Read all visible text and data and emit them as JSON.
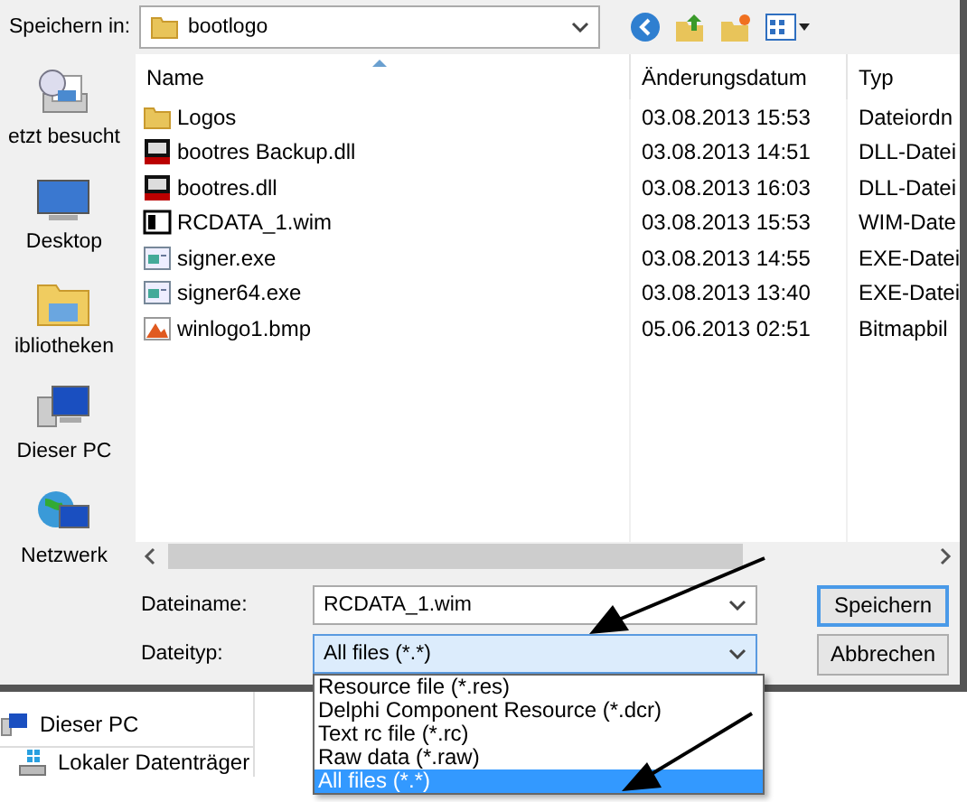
{
  "dialog": {
    "save_in_label": "Speichern in:",
    "folder": "bootlogo",
    "places": [
      {
        "label": "etzt besucht",
        "kind": "recent"
      },
      {
        "label": "Desktop",
        "kind": "desktop"
      },
      {
        "label": "ibliotheken",
        "kind": "libraries"
      },
      {
        "label": "Dieser PC",
        "kind": "pc"
      },
      {
        "label": "Netzwerk",
        "kind": "network"
      }
    ],
    "columns": [
      "Name",
      "Änderungsdatum",
      "Typ"
    ],
    "files": [
      {
        "name": "Logos",
        "kind": "folder",
        "date": "03.08.2013 15:53",
        "type": "Dateiordn"
      },
      {
        "name": "bootres Backup.dll",
        "kind": "res",
        "date": "03.08.2013 14:51",
        "type": "DLL-Datei"
      },
      {
        "name": "bootres.dll",
        "kind": "res",
        "date": "03.08.2013 16:03",
        "type": "DLL-Datei"
      },
      {
        "name": "RCDATA_1.wim",
        "kind": "archive",
        "date": "03.08.2013 15:53",
        "type": "WIM-Date"
      },
      {
        "name": "signer.exe",
        "kind": "exe",
        "date": "03.08.2013 14:55",
        "type": "EXE-Datei"
      },
      {
        "name": "signer64.exe",
        "kind": "exe",
        "date": "03.08.2013 13:40",
        "type": "EXE-Datei"
      },
      {
        "name": "winlogo1.bmp",
        "kind": "bitmap",
        "date": "05.06.2013 02:51",
        "type": "Bitmapbil"
      }
    ],
    "filename_label": "Dateiname:",
    "filename": "RCDATA_1.wim",
    "filetype_label": "Dateityp:",
    "filetype": "All files (*.*)",
    "buttons": [
      {
        "label": "Speichern",
        "default": true
      },
      {
        "label": "Abbrechen",
        "default": false
      }
    ],
    "filetype_options": [
      {
        "label": "Resource file (*.res)",
        "selected": false
      },
      {
        "label": "Delphi Component Resource (*.dcr)",
        "selected": false
      },
      {
        "label": "Text rc file (*.rc)",
        "selected": false
      },
      {
        "label": "Raw data (*.raw)",
        "selected": false
      },
      {
        "label": "All files (*.*)",
        "selected": true
      }
    ]
  },
  "background_nav": [
    {
      "label": "Dieser PC",
      "kind": "pc"
    },
    {
      "label": "Lokaler Datenträger",
      "kind": "drive"
    }
  ]
}
